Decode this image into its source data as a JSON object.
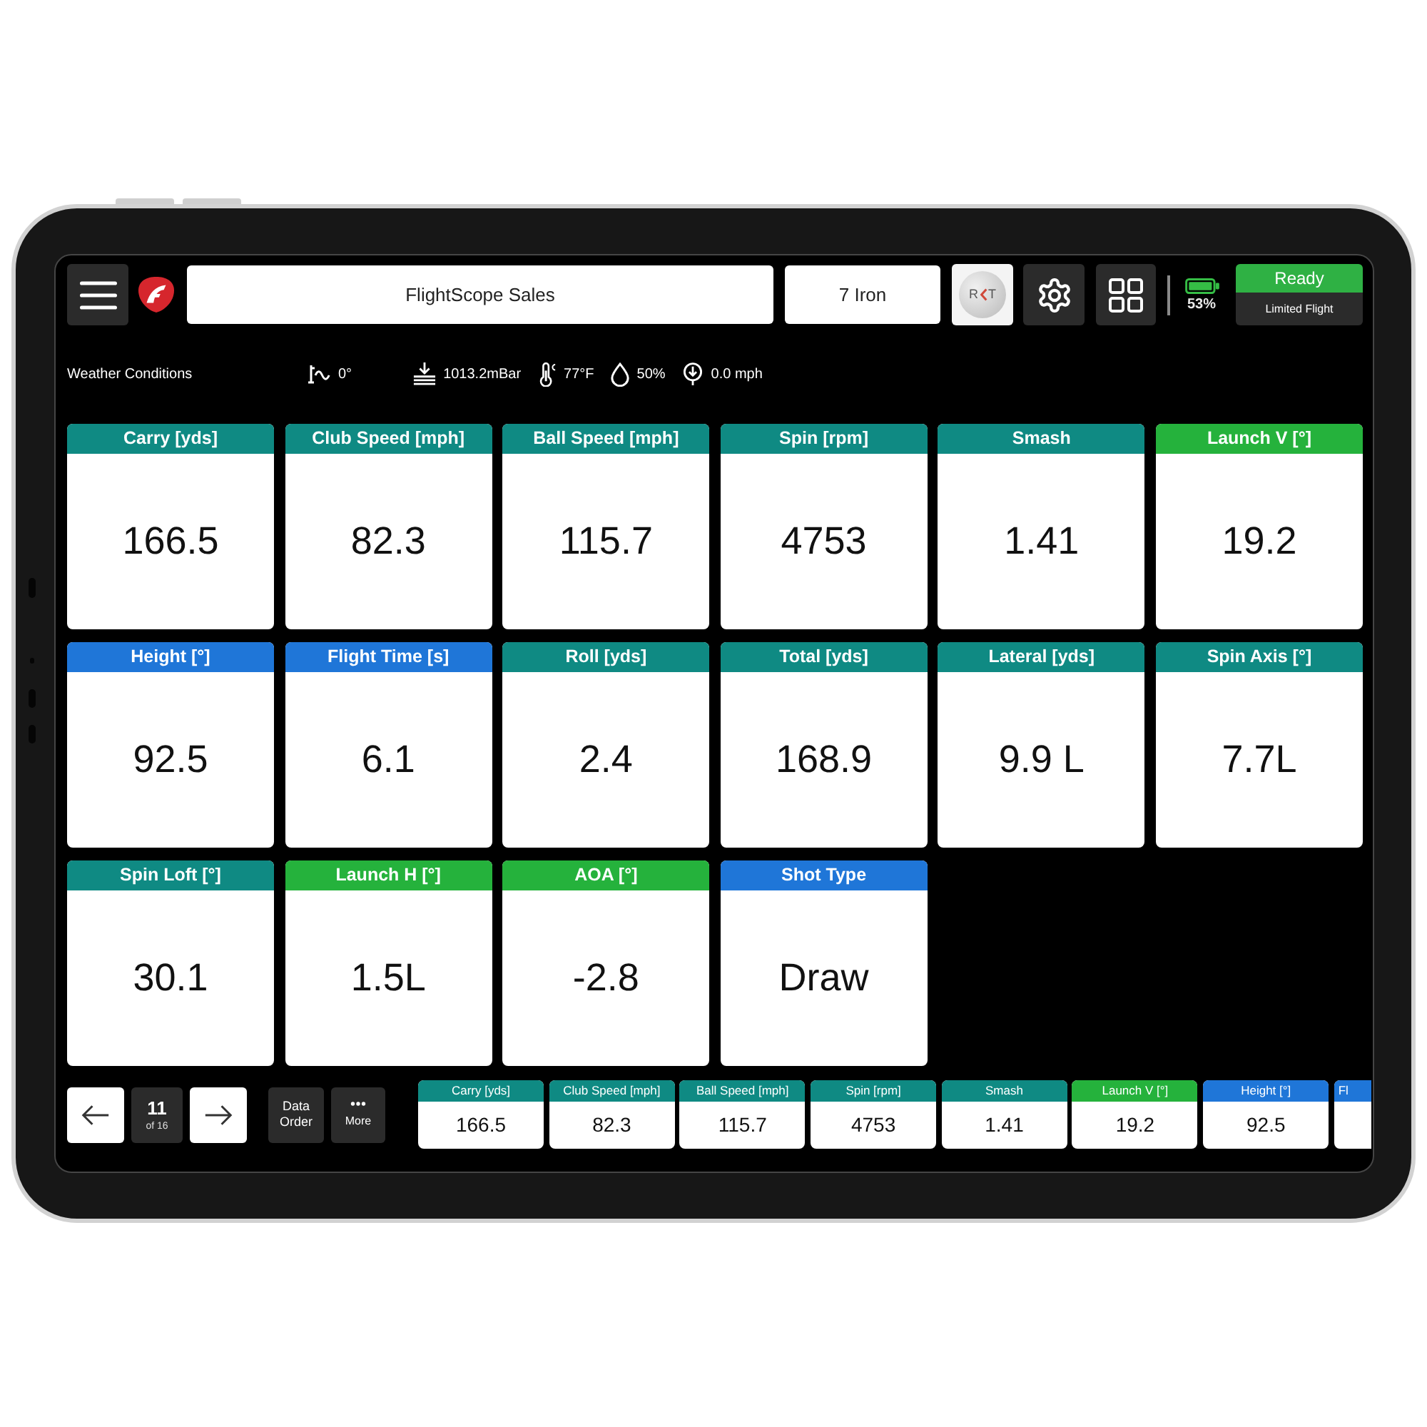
{
  "top_bar": {
    "session": "FlightScope Sales",
    "club": "7 Iron",
    "ball_badge": {
      "left": "R",
      "right": "T"
    },
    "battery": "53%",
    "status": {
      "label": "Ready",
      "mode": "Limited Flight"
    }
  },
  "weather": {
    "title": "Weather Conditions",
    "items": [
      {
        "kind": "angle",
        "value": "0°"
      },
      {
        "kind": "pressure",
        "value": "1013.2mBar"
      },
      {
        "kind": "temperature",
        "value": "77°F"
      },
      {
        "kind": "humidity",
        "value": "50%"
      },
      {
        "kind": "wind",
        "value": "0.0 mph"
      }
    ]
  },
  "tiles": [
    {
      "label": "Carry [yds]",
      "value": "166.5",
      "color": "#0f8a83"
    },
    {
      "label": "Club Speed [mph]",
      "value": "82.3",
      "color": "#0f8a83"
    },
    {
      "label": "Ball Speed [mph]",
      "value": "115.7",
      "color": "#0f8a83"
    },
    {
      "label": "Spin [rpm]",
      "value": "4753",
      "color": "#0f8a83"
    },
    {
      "label": "Smash",
      "value": "1.41",
      "color": "#0f8a83"
    },
    {
      "label": "Launch V [°]",
      "value": "19.2",
      "color": "#25b23c"
    },
    {
      "label": "Height [°]",
      "value": "92.5",
      "color": "#1f76d8"
    },
    {
      "label": "Flight Time [s]",
      "value": "6.1",
      "color": "#1f76d8"
    },
    {
      "label": "Roll [yds]",
      "value": "2.4",
      "color": "#0f8a83"
    },
    {
      "label": "Total [yds]",
      "value": "168.9",
      "color": "#0f8a83"
    },
    {
      "label": "Lateral [yds]",
      "value": "9.9 L",
      "color": "#0f8a83"
    },
    {
      "label": "Spin Axis [°]",
      "value": "7.7L",
      "color": "#0f8a83"
    },
    {
      "label": "Spin Loft [°]",
      "value": "30.1",
      "color": "#0f8a83"
    },
    {
      "label": "Launch H [°]",
      "value": "1.5L",
      "color": "#25b23c"
    },
    {
      "label": "AOA [°]",
      "value": "-2.8",
      "color": "#25b23c"
    },
    {
      "label": "Shot Type",
      "value": "Draw",
      "color": "#1f76d8"
    }
  ],
  "navigation": {
    "shot": "11",
    "total": "of 16",
    "data_order": "Data Order",
    "more": "More"
  },
  "strip": [
    {
      "kind": "full",
      "label": "Carry [yds]",
      "value": "166.5",
      "color": "#0f8a83"
    },
    {
      "kind": "full",
      "label": "Club Speed [mph]",
      "value": "82.3",
      "color": "#0f8a83"
    },
    {
      "kind": "full",
      "label": "Ball Speed [mph]",
      "value": "115.7",
      "color": "#0f8a83"
    },
    {
      "kind": "full",
      "label": "Spin [rpm]",
      "value": "4753",
      "color": "#0f8a83"
    },
    {
      "kind": "full",
      "label": "Smash",
      "value": "1.41",
      "color": "#0f8a83"
    },
    {
      "kind": "full",
      "label": "Launch V [°]",
      "value": "19.2",
      "color": "#25b23c"
    },
    {
      "kind": "full",
      "label": "Height [°]",
      "value": "92.5",
      "color": "#1f76d8"
    },
    {
      "kind": "partial",
      "label": "Fl",
      "color": "#1f76d8"
    }
  ]
}
